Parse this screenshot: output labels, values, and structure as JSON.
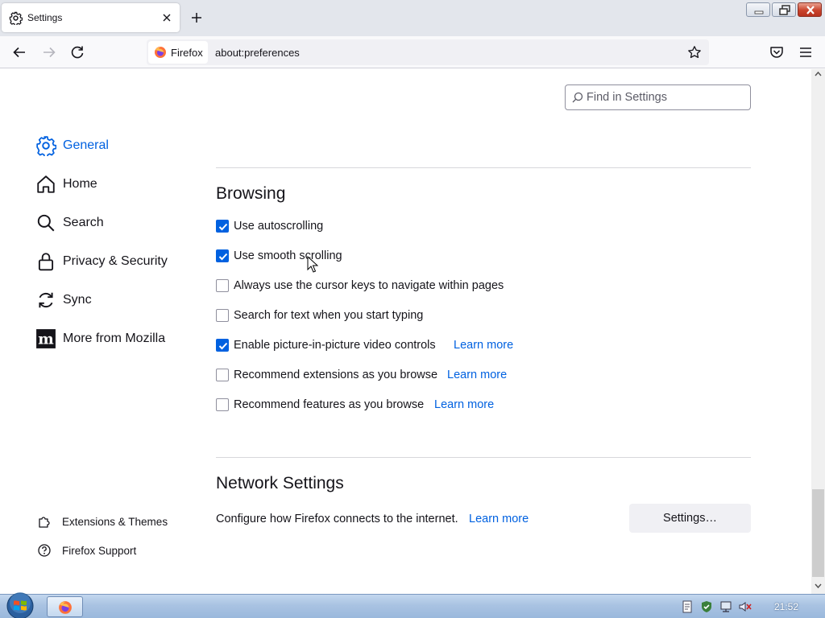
{
  "browser": {
    "tab_title": "Settings",
    "identity_label": "Firefox",
    "url": "about:preferences"
  },
  "window_controls": {
    "minimize": "minimize",
    "restore": "restore",
    "close": "close"
  },
  "settings": {
    "search_placeholder": "Find in Settings",
    "categories": [
      {
        "label": "General",
        "icon": "gear-icon",
        "selected": true
      },
      {
        "label": "Home",
        "icon": "home-icon"
      },
      {
        "label": "Search",
        "icon": "search-icon"
      },
      {
        "label": "Privacy & Security",
        "icon": "lock-icon"
      },
      {
        "label": "Sync",
        "icon": "sync-icon"
      },
      {
        "label": "More from Mozilla",
        "icon": "mozilla-icon"
      }
    ],
    "footer_links": [
      {
        "label": "Extensions & Themes",
        "icon": "puzzle-icon"
      },
      {
        "label": "Firefox Support",
        "icon": "help-icon"
      }
    ],
    "browsing": {
      "heading": "Browsing",
      "options": [
        {
          "label": "Use autoscrolling",
          "checked": true
        },
        {
          "label": "Use smooth scrolling",
          "checked": true
        },
        {
          "label": "Always use the cursor keys to navigate within pages",
          "checked": false
        },
        {
          "label": "Search for text when you start typing",
          "checked": false
        },
        {
          "label": "Enable picture-in-picture video controls",
          "checked": true,
          "learn_more": "Learn more"
        },
        {
          "label": "Recommend extensions as you browse",
          "checked": false,
          "learn_more": "Learn more"
        },
        {
          "label": "Recommend features as you browse",
          "checked": false,
          "learn_more": "Learn more"
        }
      ]
    },
    "network": {
      "heading": "Network Settings",
      "description": "Configure how Firefox connects to the internet.",
      "learn_more": "Learn more",
      "button": "Settings…"
    }
  },
  "taskbar": {
    "clock": "21:52"
  },
  "colors": {
    "accent": "#0061e0",
    "tab_strip": "#e3e6ec",
    "text": "#15141a"
  }
}
